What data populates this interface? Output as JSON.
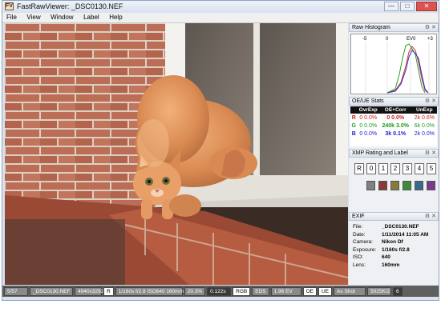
{
  "window": {
    "title": "FastRawViewer: _DSC0130.NEF",
    "app_icon": "FV",
    "minimize": "—",
    "maximize": "□",
    "close": "✕"
  },
  "menu": [
    "File",
    "View",
    "Window",
    "Label",
    "Help"
  ],
  "histogram": {
    "title": "Raw Histogram",
    "ticks": [
      "-5",
      "0",
      "EV0",
      "+3"
    ],
    "colors": {
      "red": "#d03030",
      "green": "#2aa02a",
      "blue": "#3030d0"
    }
  },
  "stats": {
    "title": "OE/UE Stats",
    "headers": [
      "",
      "OvrExp",
      "OE+Corr",
      "UnExp"
    ],
    "rows": [
      {
        "ch": "R",
        "ovr": "0 0.0%",
        "corr": "0 0.0%",
        "under": "2k 0.6%",
        "color": "#d02020"
      },
      {
        "ch": "G",
        "ovr": "0 0.0%",
        "corr": "240k 3.0%",
        "under": "6k 0.0%",
        "color": "#1f9a1f"
      },
      {
        "ch": "B",
        "ovr": "0 0.0%",
        "corr": "3k 0.1%",
        "under": "2k 0.0%",
        "color": "#2020d0"
      }
    ]
  },
  "xmp": {
    "title": "XMP Rating and Label",
    "ratings": [
      "R",
      "0",
      "1",
      "2",
      "3",
      "4",
      "5"
    ],
    "labels": [
      "#808080",
      "#8b3a3a",
      "#8a7a3a",
      "#3a8a3a",
      "#3a6a8a",
      "#7a3a8a"
    ]
  },
  "exif": {
    "title": "EXIF",
    "rows": [
      {
        "k": "File:",
        "v": "_DSC0130.NEF"
      },
      {
        "k": "Date:",
        "v": "1/11/2014 11:05 AM"
      },
      {
        "k": "Camera:",
        "v": "Nikon Df"
      },
      {
        "k": "Exposure:",
        "v": "1/160s f/2.8"
      },
      {
        "k": "ISO:",
        "v": "640"
      },
      {
        "k": "Lens:",
        "v": "160mm"
      }
    ]
  },
  "status": [
    "5/57",
    "_DSC0130.NEF",
    "4940x3292",
    "R",
    "1/160s f/2.8 ISO640 160mm",
    "20.3%",
    "0.122s",
    "RGB",
    "EDS",
    "1.96 EV",
    "OE",
    "UE",
    "As Shot",
    "5025K/2",
    "6"
  ],
  "panel_buttons": "⚙ ✕"
}
